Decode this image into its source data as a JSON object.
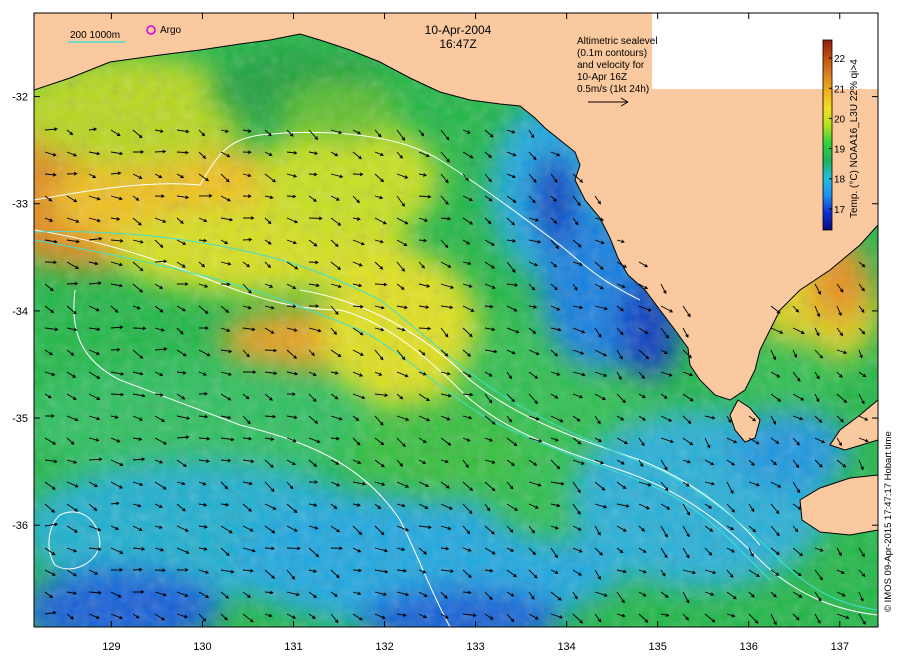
{
  "header": {
    "date": "10-Apr-2004",
    "time": "16:47Z"
  },
  "legend": {
    "depth_label": "200  1000m",
    "argo_label": "Argo",
    "argo_color": "#e000e0",
    "depth_line_color": "#40e0d0"
  },
  "altimetry_note": {
    "lines": [
      "Altimetric sealevel",
      "(0.1m contours)",
      "and velocity for",
      "10-Apr 16Z",
      "0.5m/s (1kt 24h)"
    ]
  },
  "colorbar": {
    "title": "Temp. (°C) NOAA16_L3U 22% qi>4",
    "min": 16.3,
    "max": 22.6,
    "ticks": [
      17,
      18,
      19,
      20,
      21,
      22
    ],
    "colors": [
      "#0a0a80",
      "#1030d0",
      "#2090f0",
      "#20c0e0",
      "#20b060",
      "#30d040",
      "#b0e020",
      "#f0e020",
      "#f0b020",
      "#e08020",
      "#c05010",
      "#902010"
    ]
  },
  "axes": {
    "lon_ticks": [
      129,
      130,
      131,
      132,
      133,
      134,
      135,
      136,
      137
    ],
    "lat_ticks": [
      -32,
      -33,
      -34,
      -35,
      -36
    ],
    "lon_min": 128.15,
    "lon_max": 137.42,
    "lat_min": -36.95,
    "lat_max": -31.22
  },
  "colors": {
    "land": "#fbc99f",
    "ocean_base": "#22b848",
    "contour": "#ffffff"
  },
  "credit": "© IMOS 09-Apr-2015 17:47:17 Hobart time"
}
